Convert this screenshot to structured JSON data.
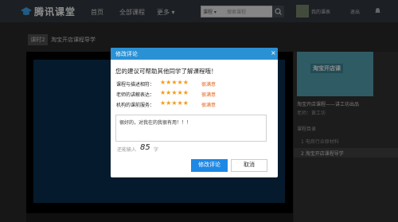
{
  "header": {
    "brand": "腾讯课堂",
    "nav": {
      "home": "首页",
      "all_courses": "全部课程",
      "more": "更多 ▾"
    },
    "search": {
      "category": "课程 ▾",
      "placeholder": "搜索课程"
    },
    "user": {
      "my_courses": "我的课表",
      "logout": "退出"
    }
  },
  "course": {
    "lesson_tag": "课时2",
    "title": "淘宝开店课程导学"
  },
  "sidebar": {
    "thumb_title": "淘宝开店课",
    "course_name": "淘宝开店课程——讲工坊出品",
    "teacher": "老师：黄工坊",
    "chapter_label": "课程目录",
    "items": [
      "1 电商行业原材料",
      "2 淘宝开店课程导学"
    ]
  },
  "dialog": {
    "title": "修改评论",
    "close": "×",
    "prompt": "您的建议可帮助其他同学了解课程哦！",
    "ratings": [
      {
        "label": "课程与描述相符：",
        "stars": "★★★★★",
        "text": "很满意",
        "value": 5
      },
      {
        "label": "老师的讲解表达：",
        "stars": "★★★★★",
        "text": "很满意",
        "value": 5
      },
      {
        "label": "机构的课前服务：",
        "stars": "★★★★★",
        "text": "很满意",
        "value": 5
      }
    ],
    "comment": "很好的，对我在的我很有用！！！",
    "remaining_label": "还能输入",
    "remaining_count": "85",
    "remaining_unit": "字",
    "submit": "修改评论",
    "cancel": "取消"
  },
  "colors": {
    "accent": "#2b91d5",
    "star": "#f39a1a",
    "rating_text": "#e0641c"
  }
}
